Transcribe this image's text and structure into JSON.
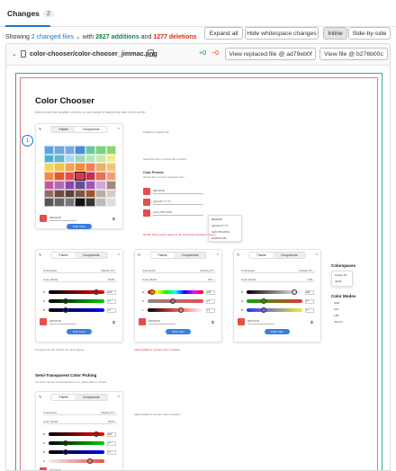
{
  "tabs": [
    {
      "label": "Changes",
      "count": "2"
    }
  ],
  "summary": {
    "prefix": "Showing",
    "changed_link": "2 changed files",
    "with": "with",
    "additions": "2827 additions",
    "and": "and",
    "deletions": "1277 deletions"
  },
  "toolbar": {
    "expand_all": "Expand all",
    "hide_whitespace": "Hide whitespace changes",
    "inline": "Inline",
    "side_by_side": "Side-by-side"
  },
  "file": {
    "path": "color-chooser/color-chooser_jimmac.png",
    "added": "+0",
    "removed": "−0",
    "view_replaced": "View replaced file @ ad79eb0f",
    "view_file": "View file @ b276b00c"
  },
  "design": {
    "title": "Color Chooser",
    "intro": "Allow to pick from a palette of colors, or use a picker to sample any color on the screen.",
    "card_tabs": [
      "Palette",
      "Components"
    ],
    "hex_value": "#E64D4D",
    "pick_color": "Pick Color",
    "notes": {
      "default_palette": "Default for palette tab",
      "palette_desc": "Swatches from a preset list of colors",
      "color_preview": "Color Preview",
      "color_preview_desc": "Shows the currently selected color",
      "components_note": "Components tab mirrors the same layout",
      "red_note": "NOTE: Show exact values in the format the developer chose",
      "alpha_note": "Alpha added to preview when enabled",
      "colorspaces": "Colorspaces",
      "color_modes": "Color Modes",
      "semi_title": "Semi-Transparent Color Picking",
      "semi_desc": "If a color can be semi-transparent, the alpha slider is shown."
    },
    "popover_items": [
      "#E64D4D",
      "rgb(230,77,77)",
      "hsl(0,75%,60%)",
      "lab(55,63,35)"
    ],
    "side_values": [
      "Display P3",
      "sRGB",
      "RGB",
      "HSL",
      "LAB"
    ],
    "mode_values": [
      "RGB",
      "HSL",
      "LAB",
      "OKLCH"
    ],
    "fields": {
      "colorspace": "Colorspace",
      "colorspace_val": "Display P3",
      "color_model": "Color Model",
      "rgb": "RGB",
      "hsl": "HSL",
      "lab": "LAB"
    },
    "slider_labels": [
      "R",
      "G",
      "B"
    ],
    "slider_labels_hsl": [
      "H",
      "S",
      "L"
    ],
    "slider_values": [
      "230",
      "77",
      "77"
    ],
    "swatch_colors": [
      "#5aa3e6",
      "#6fa8dc",
      "#7da7e0",
      "#4c8fd6",
      "#6cc7a0",
      "#7ed17e",
      "#8fd86b",
      "#4ab0d8",
      "#64b5c9",
      "#a6d9f2",
      "#9fd6c0",
      "#b7e6b0",
      "#c8e9a3",
      "#f0f08a",
      "#f4d35e",
      "#f2c14e",
      "#f6a04d",
      "#f48c3a",
      "#f37f5a",
      "#e5b26a",
      "#f0c779",
      "#f08a4b",
      "#e4572e",
      "#e64d4d",
      "#d63a4a",
      "#c6304e",
      "#e76f51",
      "#f49b7a",
      "#c9579e",
      "#b06ab3",
      "#8e44ad",
      "#6a4c93",
      "#9b59b6",
      "#cfa8d8",
      "#a1887f",
      "#8d6e63",
      "#6d4c41",
      "#5d4037",
      "#795548",
      "#a0522d",
      "#bcaaa4",
      "#d7ccc8",
      "#555555",
      "#666666",
      "#777777",
      "#111111",
      "#333333",
      "#bbbbbb",
      "#dddddd"
    ]
  }
}
